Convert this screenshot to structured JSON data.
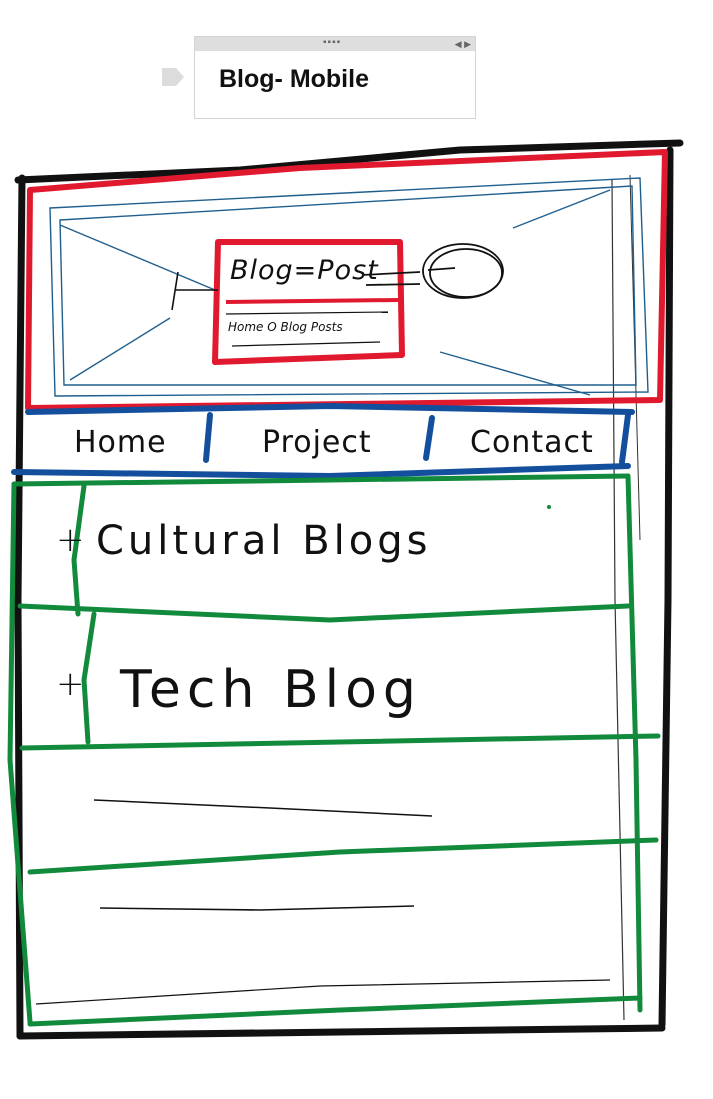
{
  "tab": {
    "title": "Blog- Mobile"
  },
  "banner": {
    "title": "Blog=Post",
    "subtitle": "Home O Blog Posts"
  },
  "nav": {
    "items": [
      "Home",
      "Project",
      "Contact"
    ]
  },
  "accordion": {
    "items": [
      {
        "label": "Cultural Blogs",
        "expander": "+"
      },
      {
        "label": "Tech Blog",
        "expander": "+"
      }
    ]
  },
  "colors": {
    "frame": "#111111",
    "header": "#e0192e",
    "nav": "#134f9c",
    "content": "#128a3c",
    "image_box": "#1f5f8e"
  }
}
